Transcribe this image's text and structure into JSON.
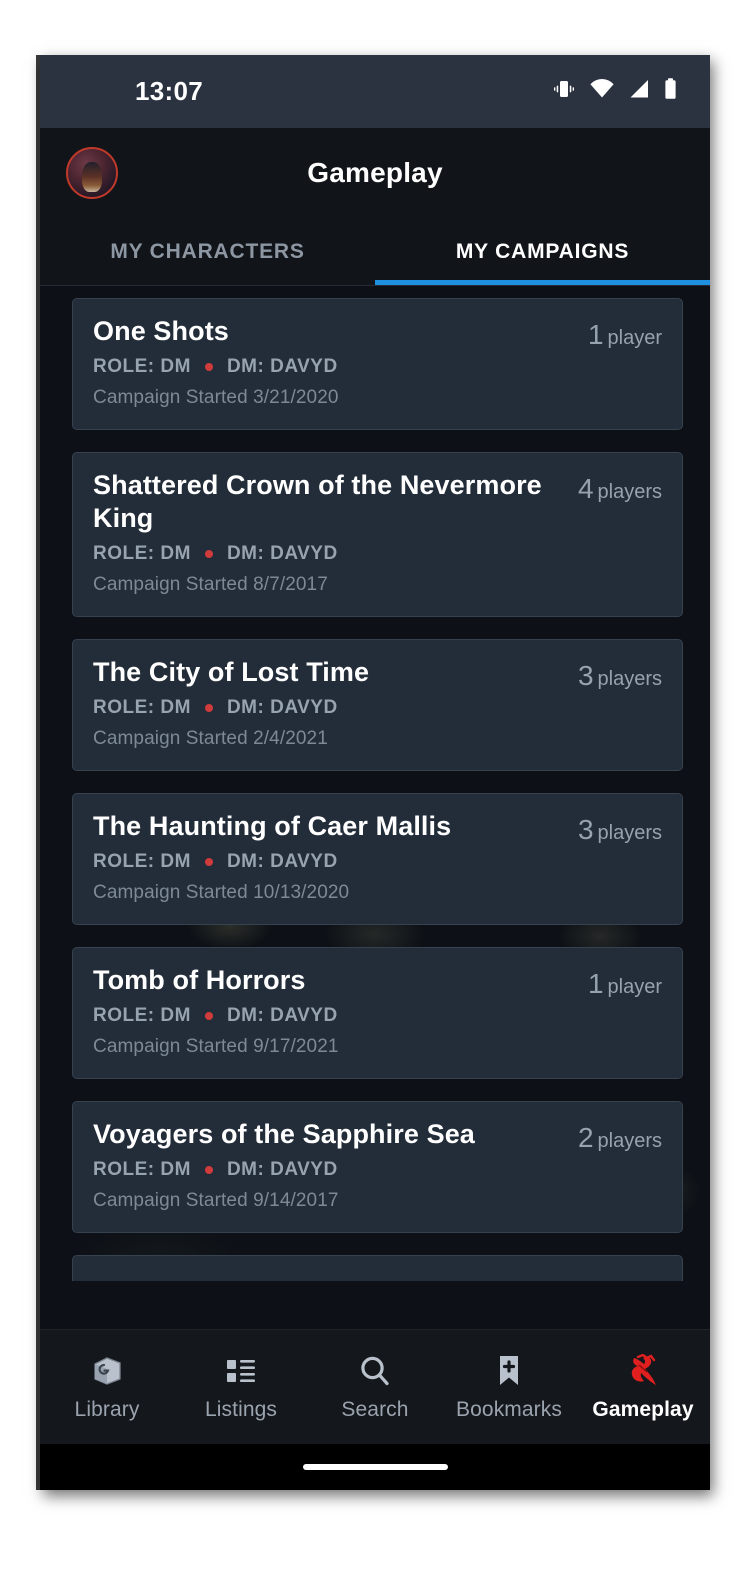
{
  "status_bar": {
    "clock": "13:07",
    "icons": [
      "vibrate-icon",
      "wifi-icon",
      "cell-signal-icon",
      "battery-icon"
    ]
  },
  "header": {
    "title": "Gameplay",
    "avatar_name": "user-avatar"
  },
  "tabs": [
    {
      "label": "MY CHARACTERS",
      "active": false
    },
    {
      "label": "MY CAMPAIGNS",
      "active": true
    }
  ],
  "colors": {
    "accent_blue": "#1f8fe0",
    "accent_red": "#d03b3b",
    "card_bg": "#232c39",
    "screen_bg": "#0d1117",
    "status_bar_bg": "#2b3240",
    "muted_text": "#98a3b0"
  },
  "campaigns": [
    {
      "title": "One Shots",
      "role": "ROLE: DM",
      "dm": "DM: DAVYD",
      "started": "Campaign Started 3/21/2020",
      "players_count": "1",
      "players_label": "player"
    },
    {
      "title": "Shattered Crown of the Nevermore King",
      "role": "ROLE: DM",
      "dm": "DM: DAVYD",
      "started": "Campaign Started 8/7/2017",
      "players_count": "4",
      "players_label": "players"
    },
    {
      "title": "The City of Lost Time",
      "role": "ROLE: DM",
      "dm": "DM: DAVYD",
      "started": "Campaign Started 2/4/2021",
      "players_count": "3",
      "players_label": "players"
    },
    {
      "title": "The Haunting of Caer Mallis",
      "role": "ROLE: DM",
      "dm": "DM: DAVYD",
      "started": "Campaign Started 10/13/2020",
      "players_count": "3",
      "players_label": "players"
    },
    {
      "title": "Tomb of Horrors",
      "role": "ROLE: DM",
      "dm": "DM: DAVYD",
      "started": "Campaign Started 9/17/2021",
      "players_count": "1",
      "players_label": "player"
    },
    {
      "title": "Voyagers of the Sapphire Sea",
      "role": "ROLE: DM",
      "dm": "DM: DAVYD",
      "started": "Campaign Started 9/14/2017",
      "players_count": "2",
      "players_label": "players"
    }
  ],
  "bottom_nav": [
    {
      "label": "Library",
      "icon": "book-icon",
      "active": false
    },
    {
      "label": "Listings",
      "icon": "list-icon",
      "active": false
    },
    {
      "label": "Search",
      "icon": "search-icon",
      "active": false
    },
    {
      "label": "Bookmarks",
      "icon": "bookmark-plus-icon",
      "active": false
    },
    {
      "label": "Gameplay",
      "icon": "ampersand-icon",
      "active": true
    }
  ]
}
